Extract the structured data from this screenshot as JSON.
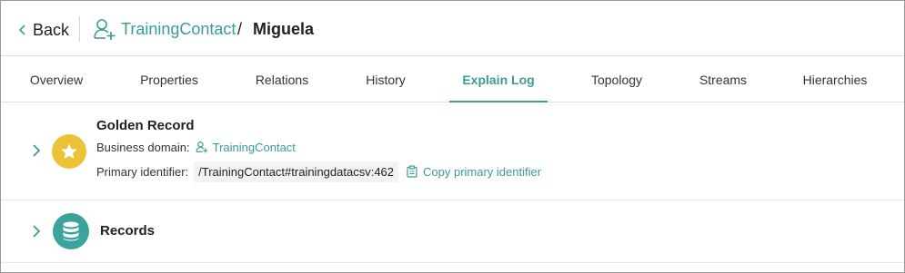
{
  "header": {
    "back_label": "Back",
    "entity_type": "TrainingContact",
    "separator": "/",
    "record_name": "Miguela",
    "accent_color": "#3a9c97"
  },
  "tabs": [
    {
      "label": "Overview",
      "active": false
    },
    {
      "label": "Properties",
      "active": false
    },
    {
      "label": "Relations",
      "active": false
    },
    {
      "label": "History",
      "active": false
    },
    {
      "label": "Explain Log",
      "active": true
    },
    {
      "label": "Topology",
      "active": false
    },
    {
      "label": "Streams",
      "active": false
    },
    {
      "label": "Hierarchies",
      "active": false
    }
  ],
  "golden_record": {
    "title": "Golden Record",
    "icon": "star-icon",
    "icon_color": "#ecc236",
    "business_domain_label": "Business domain:",
    "business_domain_value": "TrainingContact",
    "primary_identifier_label": "Primary identifier:",
    "primary_identifier_value": "/TrainingContact#trainingdatacsv:462",
    "copy_label": "Copy primary identifier"
  },
  "records": {
    "title": "Records",
    "icon": "database-icon",
    "icon_color": "#3aa39b"
  }
}
